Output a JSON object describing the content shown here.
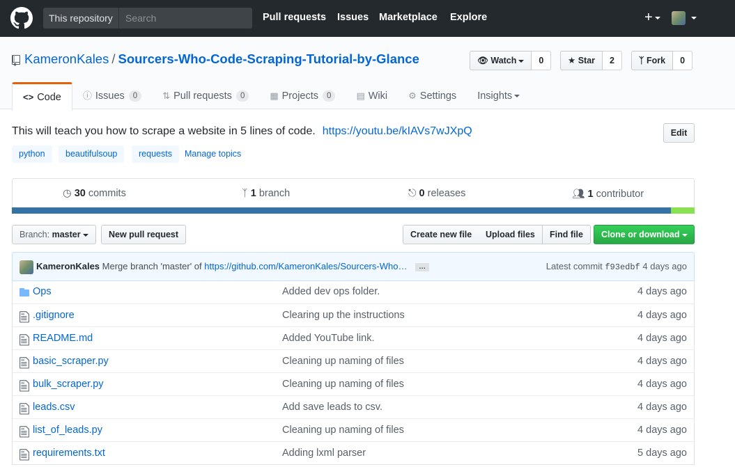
{
  "header": {
    "scope_label": "This repository",
    "search_placeholder": "Search",
    "nav": [
      "Pull requests",
      "Issues",
      "Marketplace",
      "Explore"
    ],
    "plus_label": "+"
  },
  "repo": {
    "owner": "KameronKales",
    "separator": "/",
    "name": "Sourcers-Who-Code-Scraping-Tutorial-by-Glance",
    "watch": {
      "label": "Watch",
      "count": "0"
    },
    "star": {
      "label": "Star",
      "count": "2"
    },
    "fork": {
      "label": "Fork",
      "count": "0"
    }
  },
  "tabs": [
    {
      "label": "Code",
      "icon": "code-icon",
      "selected": true
    },
    {
      "label": "Issues",
      "icon": "issue-icon",
      "count": "0"
    },
    {
      "label": "Pull requests",
      "icon": "pull-request-icon",
      "count": "0"
    },
    {
      "label": "Projects",
      "icon": "project-icon",
      "count": "0"
    },
    {
      "label": "Wiki",
      "icon": "book-icon"
    },
    {
      "label": "Settings",
      "icon": "gear-icon"
    },
    {
      "label": "Insights",
      "icon": "",
      "dropdown": true
    }
  ],
  "description": {
    "text": "This will teach you how to scrape a website in 5 lines of code.",
    "link": "https://youtu.be/kIAVs7wJXpQ",
    "edit_label": "Edit"
  },
  "topics": [
    "python",
    "beautifulsoup",
    "requests"
  ],
  "manage_topics": "Manage topics",
  "summary": {
    "commits_count": "30",
    "commits_label": "commits",
    "branches_count": "1",
    "branches_label": "branch",
    "releases_count": "0",
    "releases_label": "releases",
    "contributors_count": "1",
    "contributors_label": "contributor"
  },
  "language_colors": {
    "python": "#3572A5",
    "other": "#89e051"
  },
  "file_nav": {
    "branch_prefix": "Branch:",
    "branch_name": "master",
    "new_pr": "New pull request",
    "create_file": "Create new file",
    "upload_files": "Upload files",
    "find_file": "Find file",
    "clone": "Clone or download"
  },
  "latest_commit": {
    "author": "KameronKales",
    "message": "Merge branch 'master' of",
    "link": "https://github.com/KameronKales/Sourcers-Who…",
    "ellipsis": "…",
    "label": "Latest commit",
    "sha": "f93edbf",
    "age": "4 days ago"
  },
  "files": [
    {
      "name": "Ops",
      "type": "folder",
      "message": "Added dev ops folder.",
      "age": "4 days ago"
    },
    {
      "name": ".gitignore",
      "type": "file",
      "message": "Clearing up the instructions",
      "age": "4 days ago"
    },
    {
      "name": "README.md",
      "type": "file",
      "message": "Added YouTube link.",
      "age": "4 days ago"
    },
    {
      "name": "basic_scraper.py",
      "type": "file",
      "message": "Cleaning up naming of files",
      "age": "4 days ago"
    },
    {
      "name": "bulk_scraper.py",
      "type": "file",
      "message": "Cleaning up naming of files",
      "age": "4 days ago"
    },
    {
      "name": "leads.csv",
      "type": "file",
      "message": "Add save leads to csv.",
      "age": "4 days ago"
    },
    {
      "name": "list_of_leads.py",
      "type": "file",
      "message": "Cleaning up naming of files",
      "age": "4 days ago"
    },
    {
      "name": "requirements.txt",
      "type": "file",
      "message": "Adding lxml parser",
      "age": "5 days ago"
    }
  ]
}
